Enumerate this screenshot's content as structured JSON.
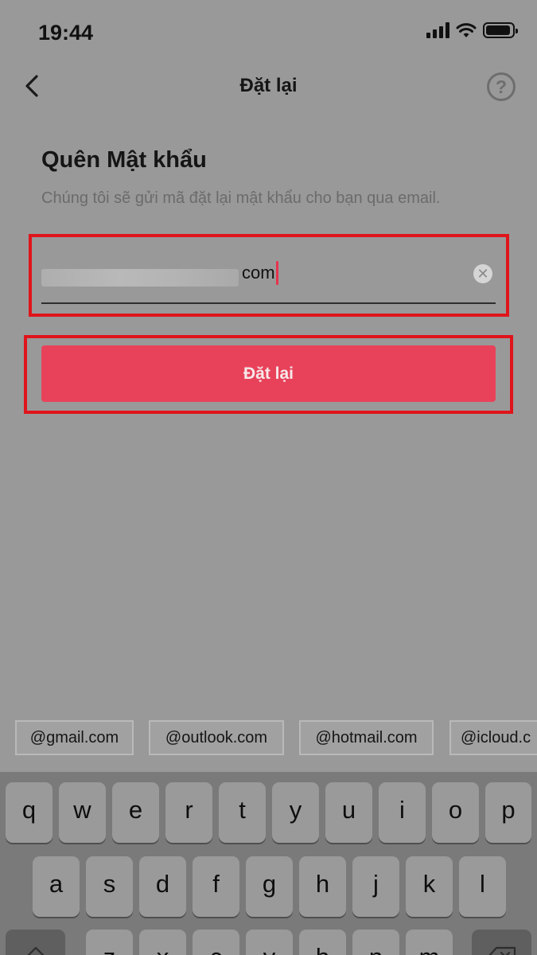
{
  "status_bar": {
    "time": "19:44"
  },
  "nav": {
    "title": "Đặt lại",
    "help_symbol": "?"
  },
  "form": {
    "heading": "Quên Mật khẩu",
    "description": "Chúng tôi sẽ gửi mã đặt lại mật khẩu cho bạn qua email.",
    "email_visible_suffix": "com",
    "clear_symbol": "✕",
    "submit_label": "Đặt lại"
  },
  "highlight_color": "#e0141b",
  "accent_color": "#e8425a",
  "email_suggestions": [
    "@gmail.com",
    "@outlook.com",
    "@hotmail.com",
    "@icloud.c"
  ],
  "keyboard": {
    "row1": [
      "q",
      "w",
      "e",
      "r",
      "t",
      "y",
      "u",
      "i",
      "o",
      "p"
    ],
    "row2": [
      "a",
      "s",
      "d",
      "f",
      "g",
      "h",
      "j",
      "k",
      "l"
    ],
    "row3": [
      "z",
      "x",
      "c",
      "v",
      "b",
      "n",
      "m"
    ],
    "shift_icon": "shift-icon",
    "delete_icon": "backspace-icon"
  }
}
